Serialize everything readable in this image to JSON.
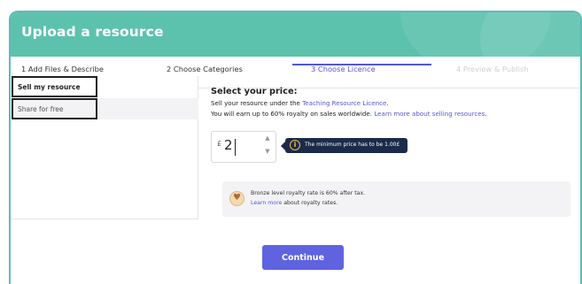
{
  "header": {
    "title": "Upload a resource"
  },
  "steps": [
    {
      "label": "1 Add Files & Describe",
      "state": "done"
    },
    {
      "label": "2 Choose Categories",
      "state": "done"
    },
    {
      "label": "3 Choose Licence",
      "state": "active"
    },
    {
      "label": "4 Preview & Publish",
      "state": "disabled"
    }
  ],
  "tabs": {
    "sell": "Sell my resource",
    "free": "Share for free"
  },
  "pricing": {
    "title": "Select your price:",
    "line1_prefix": "Sell your resource under the ",
    "line1_link": "Teaching Resource Licence",
    "line1_suffix": ".",
    "line2_prefix": "You will earn up to 60% royalty on sales worldwide. ",
    "line2_link": "Learn more about selling resources",
    "line2_suffix": "."
  },
  "price_input": {
    "currency": "£",
    "value": "2"
  },
  "tooltip": {
    "text": "The minimum price has to be 1.00£"
  },
  "royalty": {
    "line1": "Bronze level royalty rate is 60% after tax.",
    "link": "Learn more",
    "line2_suffix": " about royalty rates."
  },
  "actions": {
    "continue": "Continue"
  },
  "colors": {
    "header": "#5cc2ad",
    "accent": "#5457d9",
    "button": "#5f63e0",
    "tooltip_bg": "#1c2a4a"
  }
}
